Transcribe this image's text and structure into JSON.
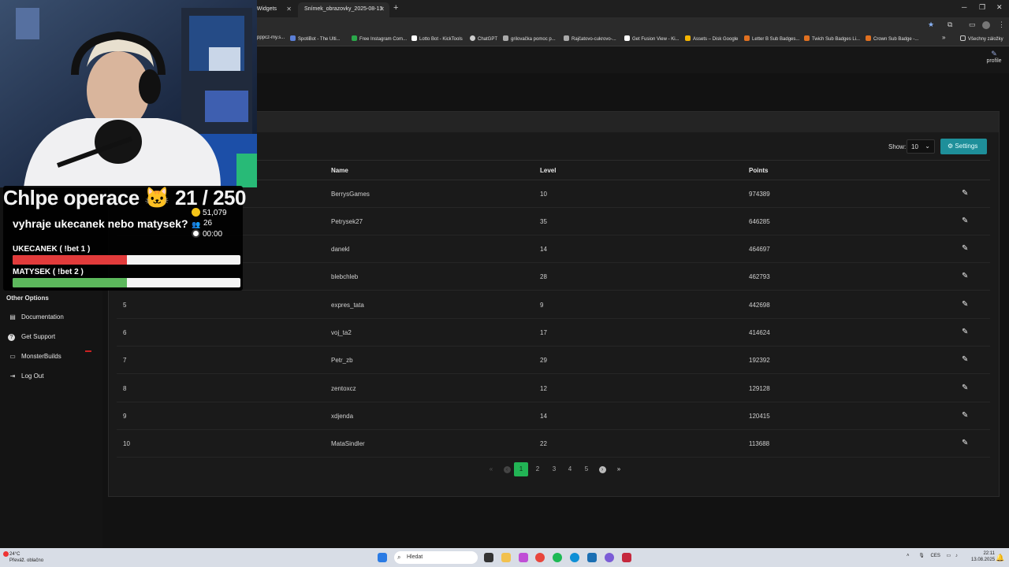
{
  "browser": {
    "tabs": [
      {
        "label": "nd Widgets",
        "active": false
      },
      {
        "label": "Snímek_obrazovky_2025-08-13",
        "active": true
      }
    ],
    "new_tab": "+",
    "bookmarks": [
      {
        "label": "pppcz-my.s...",
        "color": "#3b6fd1"
      },
      {
        "label": "SpotiBot - The Ulti...",
        "color": "#5b7fd6"
      },
      {
        "label": "Free Instagram Com...",
        "color": "#2aa84a"
      },
      {
        "label": "Lotto Bot - KickTools",
        "color": "#ffffff"
      },
      {
        "label": "ChatGPT",
        "color": "#cccccc"
      },
      {
        "label": "grilovačka pomoc p...",
        "color": "#aaaaaa"
      },
      {
        "label": "Rajčatovo-cukrovo-...",
        "color": "#aaaaaa"
      },
      {
        "label": "Get Fusion View - Ki...",
        "color": "#ffffff"
      },
      {
        "label": "Assets – Disk Google",
        "color": "#f4b400"
      },
      {
        "label": "Letter B Sub Badges...",
        "color": "#e07020"
      },
      {
        "label": "Twich Sub Badges Li...",
        "color": "#e07020"
      },
      {
        "label": "Crown Sub Badge -...",
        "color": "#e07020"
      }
    ],
    "bookmarks_overflow": "»",
    "all_bookmarks": "Všechny záložky"
  },
  "profile_label": "profile",
  "sidebar": {
    "other_options_label": "Other Options",
    "items": [
      {
        "label": "Documentation",
        "icon": "book-icon",
        "glyph": "📖"
      },
      {
        "label": "Get Support",
        "icon": "help-icon",
        "glyph": "?"
      },
      {
        "label": "MonsterBuilds",
        "icon": "monitor-icon",
        "glyph": "🖥"
      },
      {
        "label": "Log Out",
        "icon": "logout-icon",
        "glyph": "⇥"
      }
    ]
  },
  "controls": {
    "show_label": "Show:",
    "show_value": "10",
    "settings_label": "Settings"
  },
  "table": {
    "columns": [
      "Name",
      "Level",
      "Points"
    ],
    "rows": [
      {
        "rank": "",
        "name": "BerrysGames",
        "level": "10",
        "points": "974389"
      },
      {
        "rank": "",
        "name": "Petrysek27",
        "level": "35",
        "points": "646285"
      },
      {
        "rank": "",
        "name": "danekl",
        "level": "14",
        "points": "464697"
      },
      {
        "rank": "",
        "name": "blebchleb",
        "level": "28",
        "points": "462793"
      },
      {
        "rank": "5",
        "name": "expres_tata",
        "level": "9",
        "points": "442698"
      },
      {
        "rank": "6",
        "name": "voj_ta2",
        "level": "17",
        "points": "414624"
      },
      {
        "rank": "7",
        "name": "Petr_zb",
        "level": "29",
        "points": "192392"
      },
      {
        "rank": "8",
        "name": "zentoxcz",
        "level": "12",
        "points": "129128"
      },
      {
        "rank": "9",
        "name": "xdjenda",
        "level": "14",
        "points": "120415"
      },
      {
        "rank": "10",
        "name": "MataSindler",
        "level": "22",
        "points": "113688"
      }
    ]
  },
  "pagination": {
    "first": "«",
    "prev": "‹",
    "pages": [
      "1",
      "2",
      "3",
      "4",
      "5"
    ],
    "current": "1",
    "next": "›",
    "last": "»"
  },
  "overlay": {
    "title": "Chlpe operace 🐱  21 / 250",
    "question": "vyhraje ukecanek nebo matysek?",
    "coins": "51,079",
    "users": "26",
    "timer": "00:00",
    "options": [
      {
        "label": "UKECANEK ( !bet 1 )",
        "share": 0.5,
        "color": "#e23b3b"
      },
      {
        "label": "MATYSEK ( !bet 2 )",
        "share": 0.5,
        "color": "#5cb85c"
      }
    ]
  },
  "taskbar": {
    "weather_temp": "24°C",
    "weather_desc": "Převáž. oblačno",
    "search_placeholder": "Hledat",
    "lang": "CES",
    "time": "22:11",
    "date": "13.08.2025"
  }
}
